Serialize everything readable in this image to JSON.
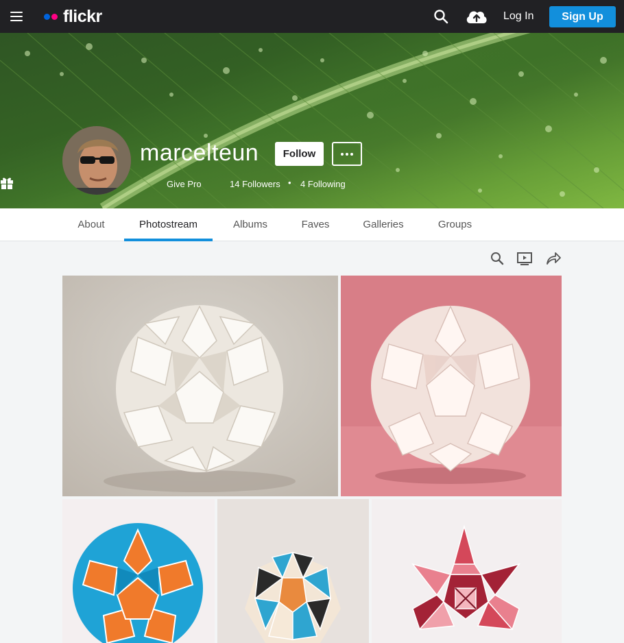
{
  "topbar": {
    "brand": "flickr",
    "brand_colors": {
      "blue": "#0063dc",
      "pink": "#ff0084"
    },
    "login_label": "Log In",
    "signup_label": "Sign Up",
    "icons": [
      "menu-icon",
      "search-icon",
      "upload-cloud-icon"
    ]
  },
  "profile": {
    "username": "marcelteun",
    "follow_label": "Follow",
    "more_label": "•••",
    "give_pro_label": "Give Pro",
    "followers_label": "14 Followers",
    "separator": "•",
    "following_label": "4 Following"
  },
  "tabs": [
    {
      "label": "About"
    },
    {
      "label": "Photostream",
      "active": true
    },
    {
      "label": "Albums"
    },
    {
      "label": "Faves"
    },
    {
      "label": "Galleries"
    },
    {
      "label": "Groups"
    }
  ],
  "toolbar_icons": [
    "search-icon",
    "slideshow-icon",
    "share-icon"
  ],
  "colors": {
    "accent": "#128fdc",
    "topbar_bg": "#212124",
    "page_bg": "#f3f5f6"
  },
  "photos": [
    {
      "subject": "white origami polyhedron on grey background"
    },
    {
      "subject": "white origami polyhedron on pink background"
    },
    {
      "subject": "orange and blue origami star polyhedron"
    },
    {
      "subject": "blue, black and cream origami polyhedron"
    },
    {
      "subject": "red and pink origami star polyhedron"
    }
  ]
}
